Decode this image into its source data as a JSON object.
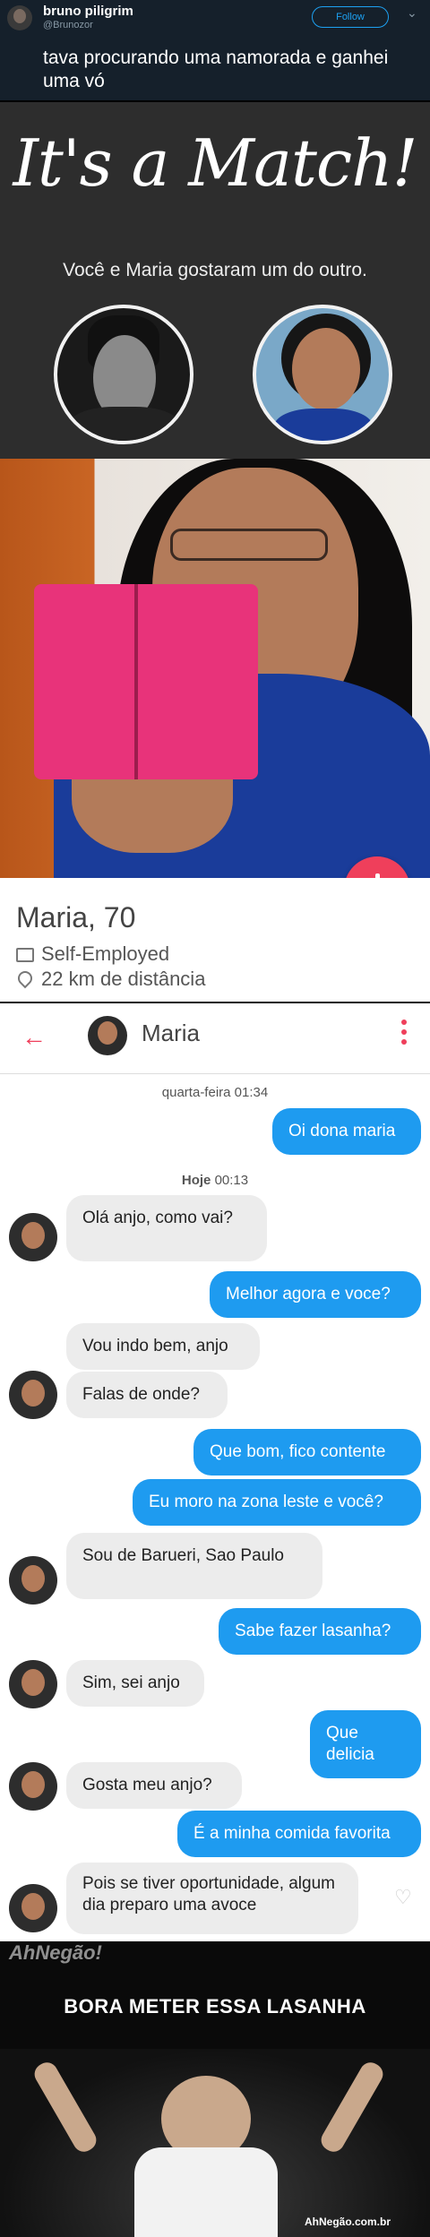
{
  "tweet": {
    "author_name": "bruno piligrim",
    "author_handle": "@Brunozor",
    "follow_label": "Follow",
    "text": "tava procurando uma namorada e ganhei uma vó"
  },
  "match": {
    "title": "It's a Match!",
    "subtitle": "Você e Maria gostaram um do outro."
  },
  "profile": {
    "name_age": "Maria, 70",
    "job": "Self-Employed",
    "distance": "22 km de distância"
  },
  "chat_header": {
    "back_icon": "arrow-left-icon",
    "contact_name": "Maria",
    "more_icon": "more-vertical-icon",
    "accent": "#ef3f5b"
  },
  "conversation": {
    "day1": {
      "label": "quarta-feira",
      "time": "01:34"
    },
    "day2": {
      "label": "Hoje",
      "time": "00:13"
    },
    "messages": [
      {
        "dir": "out",
        "text": "Oi dona maria"
      },
      {
        "dir": "in",
        "text": "Olá anjo, como vai?"
      },
      {
        "dir": "out",
        "text": "Melhor agora e voce?"
      },
      {
        "dir": "in",
        "text": "Vou indo bem, anjo"
      },
      {
        "dir": "in",
        "text": "Falas de onde?"
      },
      {
        "dir": "out",
        "text": "Que bom, fico contente"
      },
      {
        "dir": "out",
        "text": "Eu moro na zona leste e você?"
      },
      {
        "dir": "in",
        "text": "Sou de Barueri, Sao Paulo"
      },
      {
        "dir": "out",
        "text": "Sabe fazer lasanha?"
      },
      {
        "dir": "in",
        "text": "Sim, sei anjo"
      },
      {
        "dir": "out",
        "text": "Que delicia"
      },
      {
        "dir": "in",
        "text": "Gosta meu anjo?"
      },
      {
        "dir": "out",
        "text": "É a minha comida favorita"
      },
      {
        "dir": "in",
        "text": "Pois se tiver oportunidade, algum dia preparo uma avoce"
      }
    ],
    "out_color": "#1e9bf0",
    "in_color": "#ececec"
  },
  "meme": {
    "caption": "BORA METER ESSA LASANHA",
    "watermark_top": "AhNegão!",
    "watermark_bottom": "AhNegão.com.br"
  }
}
